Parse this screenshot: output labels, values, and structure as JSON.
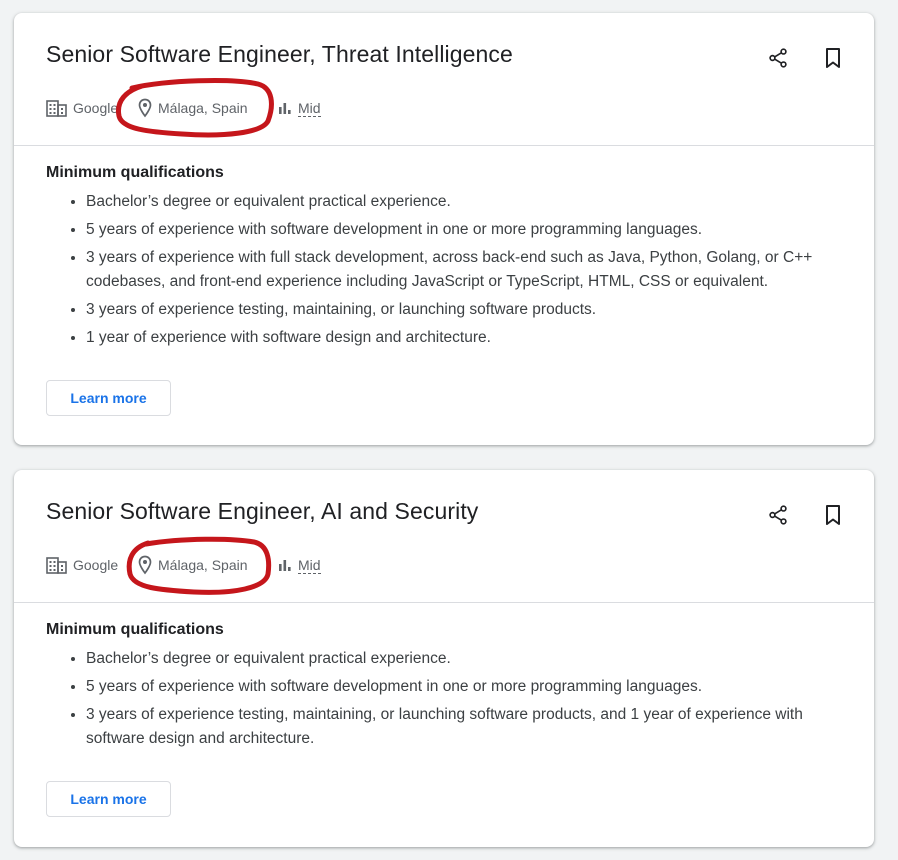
{
  "colors": {
    "accent": "#1a73e8",
    "annotation": "#c5161b",
    "text_primary": "#202124",
    "text_secondary": "#5f6368"
  },
  "icons": {
    "share": "share-icon",
    "save": "bookmark-icon",
    "company": "building-icon",
    "location": "location-pin-icon",
    "level": "bar-chart-icon"
  },
  "jobs": [
    {
      "title": "Senior Software Engineer, Threat Intelligence",
      "company": "Google",
      "location": "Málaga, Spain",
      "level": "Mid",
      "section_title": "Minimum qualifications",
      "qualifications": [
        "Bachelor’s degree or equivalent practical experience.",
        "5 years of experience with software development in one or more programming languages.",
        "3 years of experience with full stack development, across back-end such as Java, Python, Golang, or C++ codebases, and front-end experience including JavaScript or TypeScript, HTML, CSS or equivalent.",
        "3 years of experience testing, maintaining, or launching software products.",
        "1 year of experience with software design and architecture."
      ],
      "learn_more": "Learn more"
    },
    {
      "title": "Senior Software Engineer, AI and Security",
      "company": "Google",
      "location": "Málaga, Spain",
      "level": "Mid",
      "section_title": "Minimum qualifications",
      "qualifications": [
        "Bachelor’s degree or equivalent practical experience.",
        "5 years of experience with software development in one or more programming languages.",
        "3 years of experience testing, maintaining, or launching software products, and 1 year of experience with software design and architecture."
      ],
      "learn_more": "Learn more"
    }
  ]
}
